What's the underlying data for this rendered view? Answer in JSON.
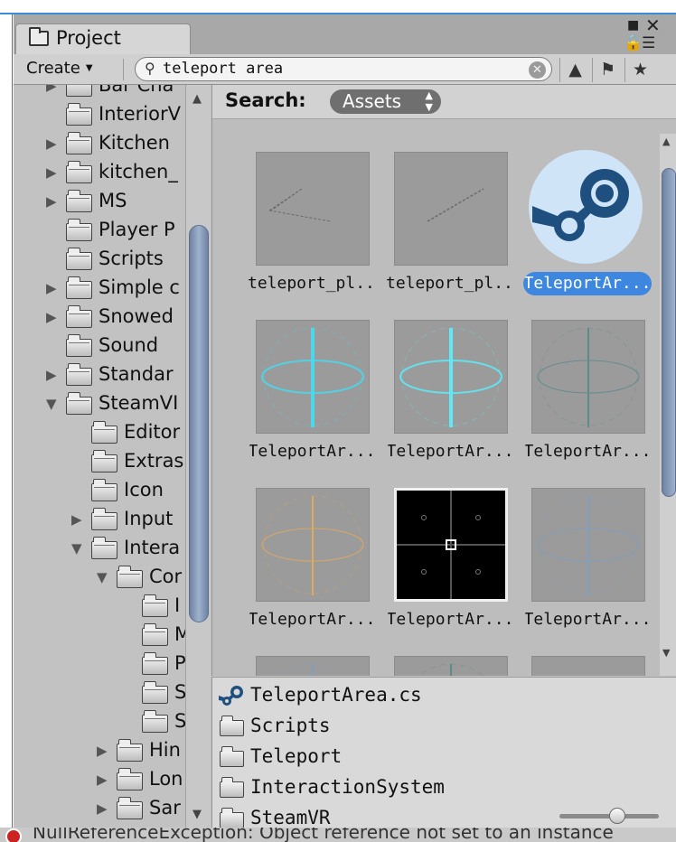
{
  "window": {
    "tab_label": "Project",
    "error_message": "NullReferenceException: Object reference not set to an instance"
  },
  "toolbar": {
    "create_label": "Create",
    "search_value": "teleport area",
    "icons": [
      "search-by-type-icon",
      "search-by-label-icon",
      "favorite-star-icon"
    ]
  },
  "tree": {
    "items": [
      {
        "label": "Bar Cha",
        "expanded": false
      },
      {
        "label": "InteriorV",
        "expanded": null
      },
      {
        "label": "Kitchen",
        "expanded": false
      },
      {
        "label": "kitchen_",
        "expanded": false
      },
      {
        "label": "MS",
        "expanded": false
      },
      {
        "label": "Player P",
        "expanded": null
      },
      {
        "label": "Scripts",
        "expanded": null
      },
      {
        "label": "Simple c",
        "expanded": false
      },
      {
        "label": "Snowed",
        "expanded": false
      },
      {
        "label": "Sound",
        "expanded": null
      },
      {
        "label": "Standar",
        "expanded": false
      },
      {
        "label": "SteamVI",
        "expanded": true
      },
      {
        "label": "Editor",
        "expanded": null
      },
      {
        "label": "Extras",
        "expanded": null
      },
      {
        "label": "Icon",
        "expanded": null
      },
      {
        "label": "Input",
        "expanded": false
      },
      {
        "label": "Intera",
        "expanded": true
      },
      {
        "label": "Cor",
        "expanded": true
      },
      {
        "label": "I",
        "expanded": null
      },
      {
        "label": "M",
        "expanded": null
      },
      {
        "label": "P",
        "expanded": null
      },
      {
        "label": "S",
        "expanded": null
      },
      {
        "label": "S",
        "expanded": null
      },
      {
        "label": "Hin",
        "expanded": false
      },
      {
        "label": "Lon",
        "expanded": false
      },
      {
        "label": "Sar",
        "expanded": false
      }
    ]
  },
  "search_bar": {
    "label": "Search:",
    "scope": "Assets"
  },
  "assets": [
    {
      "name": "teleport_pl...",
      "kind": "plane-wire",
      "selected": false
    },
    {
      "name": "teleport_pl...",
      "kind": "line-wire",
      "selected": false
    },
    {
      "name": "TeleportAr...",
      "kind": "steam-script",
      "selected": true
    },
    {
      "name": "TeleportAr...",
      "kind": "cyan-bright",
      "selected": false
    },
    {
      "name": "TeleportAr...",
      "kind": "cyan-glow",
      "selected": false
    },
    {
      "name": "TeleportAr...",
      "kind": "gray-teal",
      "selected": false
    },
    {
      "name": "TeleportAr...",
      "kind": "orange",
      "selected": false
    },
    {
      "name": "TeleportAr...",
      "kind": "black-texture",
      "selected": false
    },
    {
      "name": "TeleportAr...",
      "kind": "blue-faint",
      "selected": false
    }
  ],
  "path": {
    "items": [
      {
        "label": "TeleportArea.cs",
        "icon": "steam-icon"
      },
      {
        "label": "Scripts",
        "icon": "folder-icon"
      },
      {
        "label": "Teleport",
        "icon": "folder-icon"
      },
      {
        "label": "InteractionSystem",
        "icon": "folder-icon"
      },
      {
        "label": "SteamVR",
        "icon": "folder-icon"
      }
    ],
    "zoom_level": 0.6
  },
  "colors": {
    "selection": "#3d87e0",
    "steam_blue": "#1e4f7e",
    "steam_bg": "#cfe4f7",
    "scrollbar": "#8aa0bf",
    "title_accent": "#3a8dd6"
  }
}
